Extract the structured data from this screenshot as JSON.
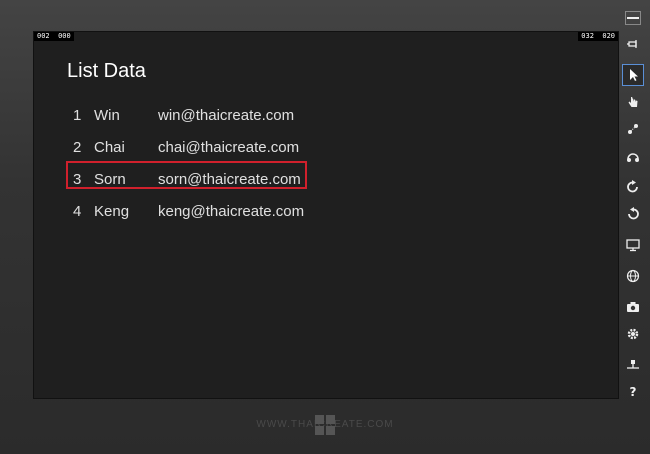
{
  "screen": {
    "counter_left": "002  000",
    "counter_right": "032  020",
    "title": "List Data",
    "rows": [
      {
        "id": "1",
        "name": "Win",
        "email": "win@thaicreate.com"
      },
      {
        "id": "2",
        "name": "Chai",
        "email": "chai@thaicreate.com"
      },
      {
        "id": "3",
        "name": "Sorn",
        "email": "sorn@thaicreate.com"
      },
      {
        "id": "4",
        "name": "Keng",
        "email": "keng@thaicreate.com"
      }
    ],
    "selected_row": "3"
  },
  "toolbar": {
    "items": [
      "minimize-icon",
      "pin-icon",
      "pointer-icon",
      "touch-hand-icon",
      "pinch-zoom-icon",
      "rotate-touch-icon",
      "rotate-clockwise-icon",
      "rotate-counterclockwise-icon",
      "resolution-monitor-icon",
      "network-globe-icon",
      "screenshot-camera-icon",
      "settings-gear-icon",
      "location-icon",
      "help-icon"
    ],
    "help_glyph": "?"
  },
  "footer": {
    "watermark": "WWW.THAICREATE.COM"
  },
  "colors": {
    "selection_border": "#d0202c",
    "screen_bg": "#1f1f1f",
    "active_tool_border": "#5a8fd6"
  }
}
